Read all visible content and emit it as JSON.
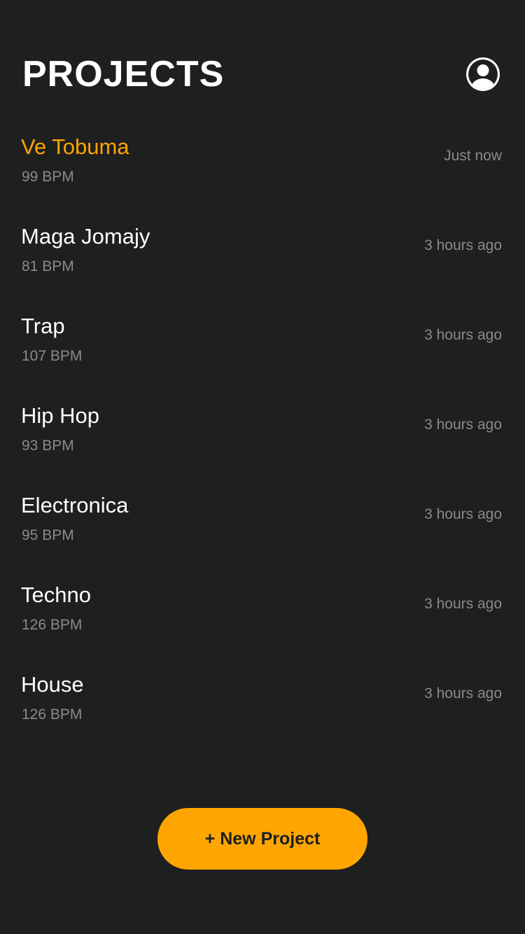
{
  "header": {
    "title": "PROJECTS",
    "profile_icon": "account-circle-icon"
  },
  "colors": {
    "background": "#1e1f1f",
    "accent": "#ffa502",
    "primary_text": "#ffffff",
    "secondary_text": "#8a8a8a"
  },
  "projects": [
    {
      "name": "Ve Tobuma",
      "bpm": "99 BPM",
      "time": "Just now",
      "active": true
    },
    {
      "name": "Maga Jomajy",
      "bpm": "81 BPM",
      "time": "3 hours ago",
      "active": false
    },
    {
      "name": "Trap",
      "bpm": "107 BPM",
      "time": "3 hours ago",
      "active": false
    },
    {
      "name": "Hip Hop",
      "bpm": "93 BPM",
      "time": "3 hours ago",
      "active": false
    },
    {
      "name": "Electronica",
      "bpm": "95 BPM",
      "time": "3 hours ago",
      "active": false
    },
    {
      "name": "Techno",
      "bpm": "126 BPM",
      "time": "3 hours ago",
      "active": false
    },
    {
      "name": "House",
      "bpm": "126 BPM",
      "time": "3 hours ago",
      "active": false
    }
  ],
  "footer": {
    "new_project_label": "+ New Project"
  }
}
